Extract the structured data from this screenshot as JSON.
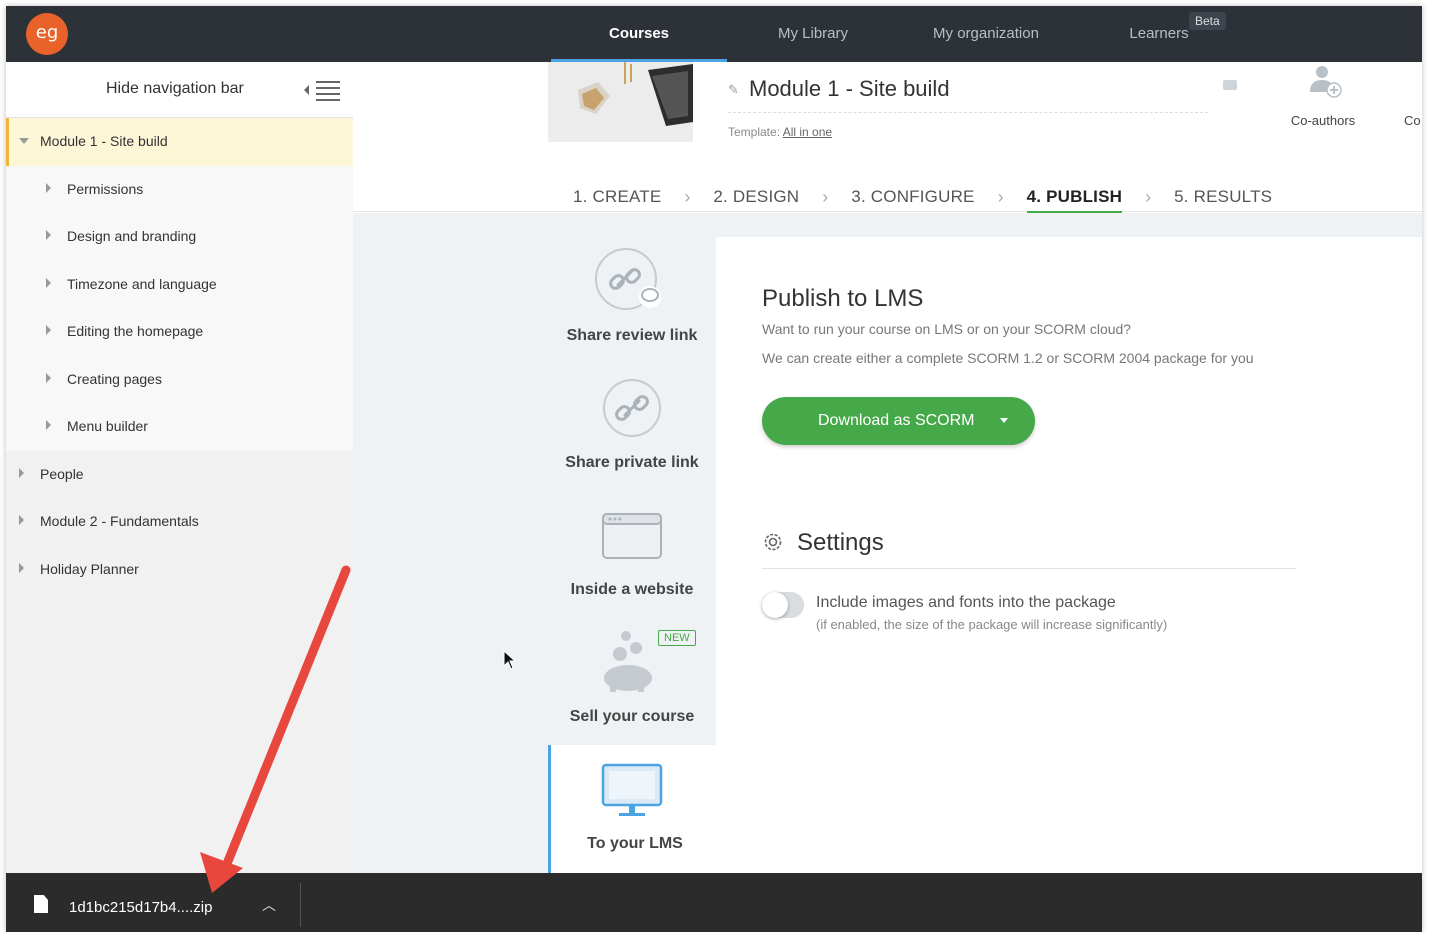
{
  "topbar": {
    "logo": "eg",
    "nav": [
      {
        "label": "Courses",
        "active": true
      },
      {
        "label": "My Library",
        "active": false
      },
      {
        "label": "My organization",
        "active": false
      },
      {
        "label": "Learners",
        "active": false
      }
    ],
    "beta_badge": "Beta"
  },
  "sidebar": {
    "hide_label": "Hide navigation bar",
    "items": [
      {
        "label": "Module 1 - Site build",
        "level": 0,
        "expanded": true,
        "active": true
      },
      {
        "label": "Permissions",
        "level": 1
      },
      {
        "label": "Design and branding",
        "level": 1
      },
      {
        "label": "Timezone and language",
        "level": 1
      },
      {
        "label": "Editing the homepage",
        "level": 1
      },
      {
        "label": "Creating pages",
        "level": 1
      },
      {
        "label": "Menu builder",
        "level": 1
      },
      {
        "label": "People",
        "level": 0
      },
      {
        "label": "Module 2 - Fundamentals",
        "level": 0
      },
      {
        "label": "Holiday Planner",
        "level": 0
      }
    ]
  },
  "header": {
    "module_title": "Module 1 - Site build",
    "template_label": "Template:",
    "template_value": "All in one",
    "coauthors_label": "Co-authors",
    "cut_label": "Co"
  },
  "steps": [
    {
      "label": "1. CREATE",
      "active": false
    },
    {
      "label": "2. DESIGN",
      "active": false
    },
    {
      "label": "3. CONFIGURE",
      "active": false
    },
    {
      "label": "4. PUBLISH",
      "active": true
    },
    {
      "label": "5. RESULTS",
      "active": false
    }
  ],
  "options": [
    {
      "label": "Share review link",
      "icon": "link-chat-icon"
    },
    {
      "label": "Share private link",
      "icon": "link-icon"
    },
    {
      "label": "Inside a website",
      "icon": "browser-window-icon"
    },
    {
      "label": "Sell your course",
      "icon": "piggy-bank-icon",
      "badge": "NEW"
    },
    {
      "label": "To your LMS",
      "icon": "monitor-icon",
      "active": true
    }
  ],
  "publish": {
    "title": "Publish to LMS",
    "line1": "Want to run your course on LMS or on your SCORM cloud?",
    "line2": "We can create either a complete SCORM 1.2 or SCORM 2004 package for you",
    "button": "Download as SCORM"
  },
  "settings": {
    "title": "Settings",
    "option_label": "Include images and fonts into the package",
    "option_note": "(if enabled, the size of the package will increase significantly)",
    "option_enabled": false
  },
  "download_bar": {
    "file_name": "1d1bc215d17b4....zip"
  },
  "colors": {
    "topbar": "#2d3239",
    "accent_green": "#45a849",
    "accent_blue": "#4ba3e3",
    "active_item_bg": "#fdf6d7",
    "arrow_red": "#e8473d"
  }
}
